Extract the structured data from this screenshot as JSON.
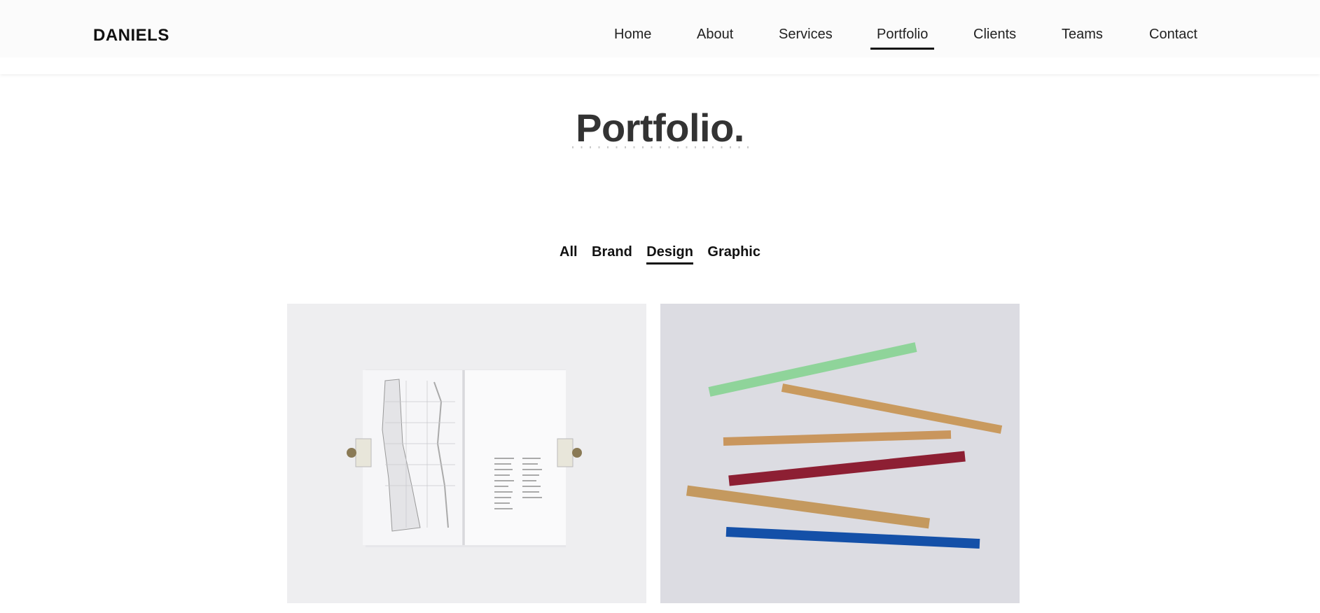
{
  "header": {
    "logo": "DANIELS",
    "nav": [
      {
        "label": "Home",
        "active": false
      },
      {
        "label": "About",
        "active": false
      },
      {
        "label": "Services",
        "active": false
      },
      {
        "label": "Portfolio",
        "active": true
      },
      {
        "label": "Clients",
        "active": false
      },
      {
        "label": "Teams",
        "active": false
      },
      {
        "label": "Contact",
        "active": false
      }
    ]
  },
  "main": {
    "title": "Portfolio.",
    "filters": [
      {
        "label": "All",
        "active": false
      },
      {
        "label": "Brand",
        "active": false
      },
      {
        "label": "Design",
        "active": true
      },
      {
        "label": "Graphic",
        "active": false
      }
    ],
    "items": [
      {
        "image": "open-book-with-map"
      },
      {
        "image": "colored-rulers"
      }
    ]
  }
}
